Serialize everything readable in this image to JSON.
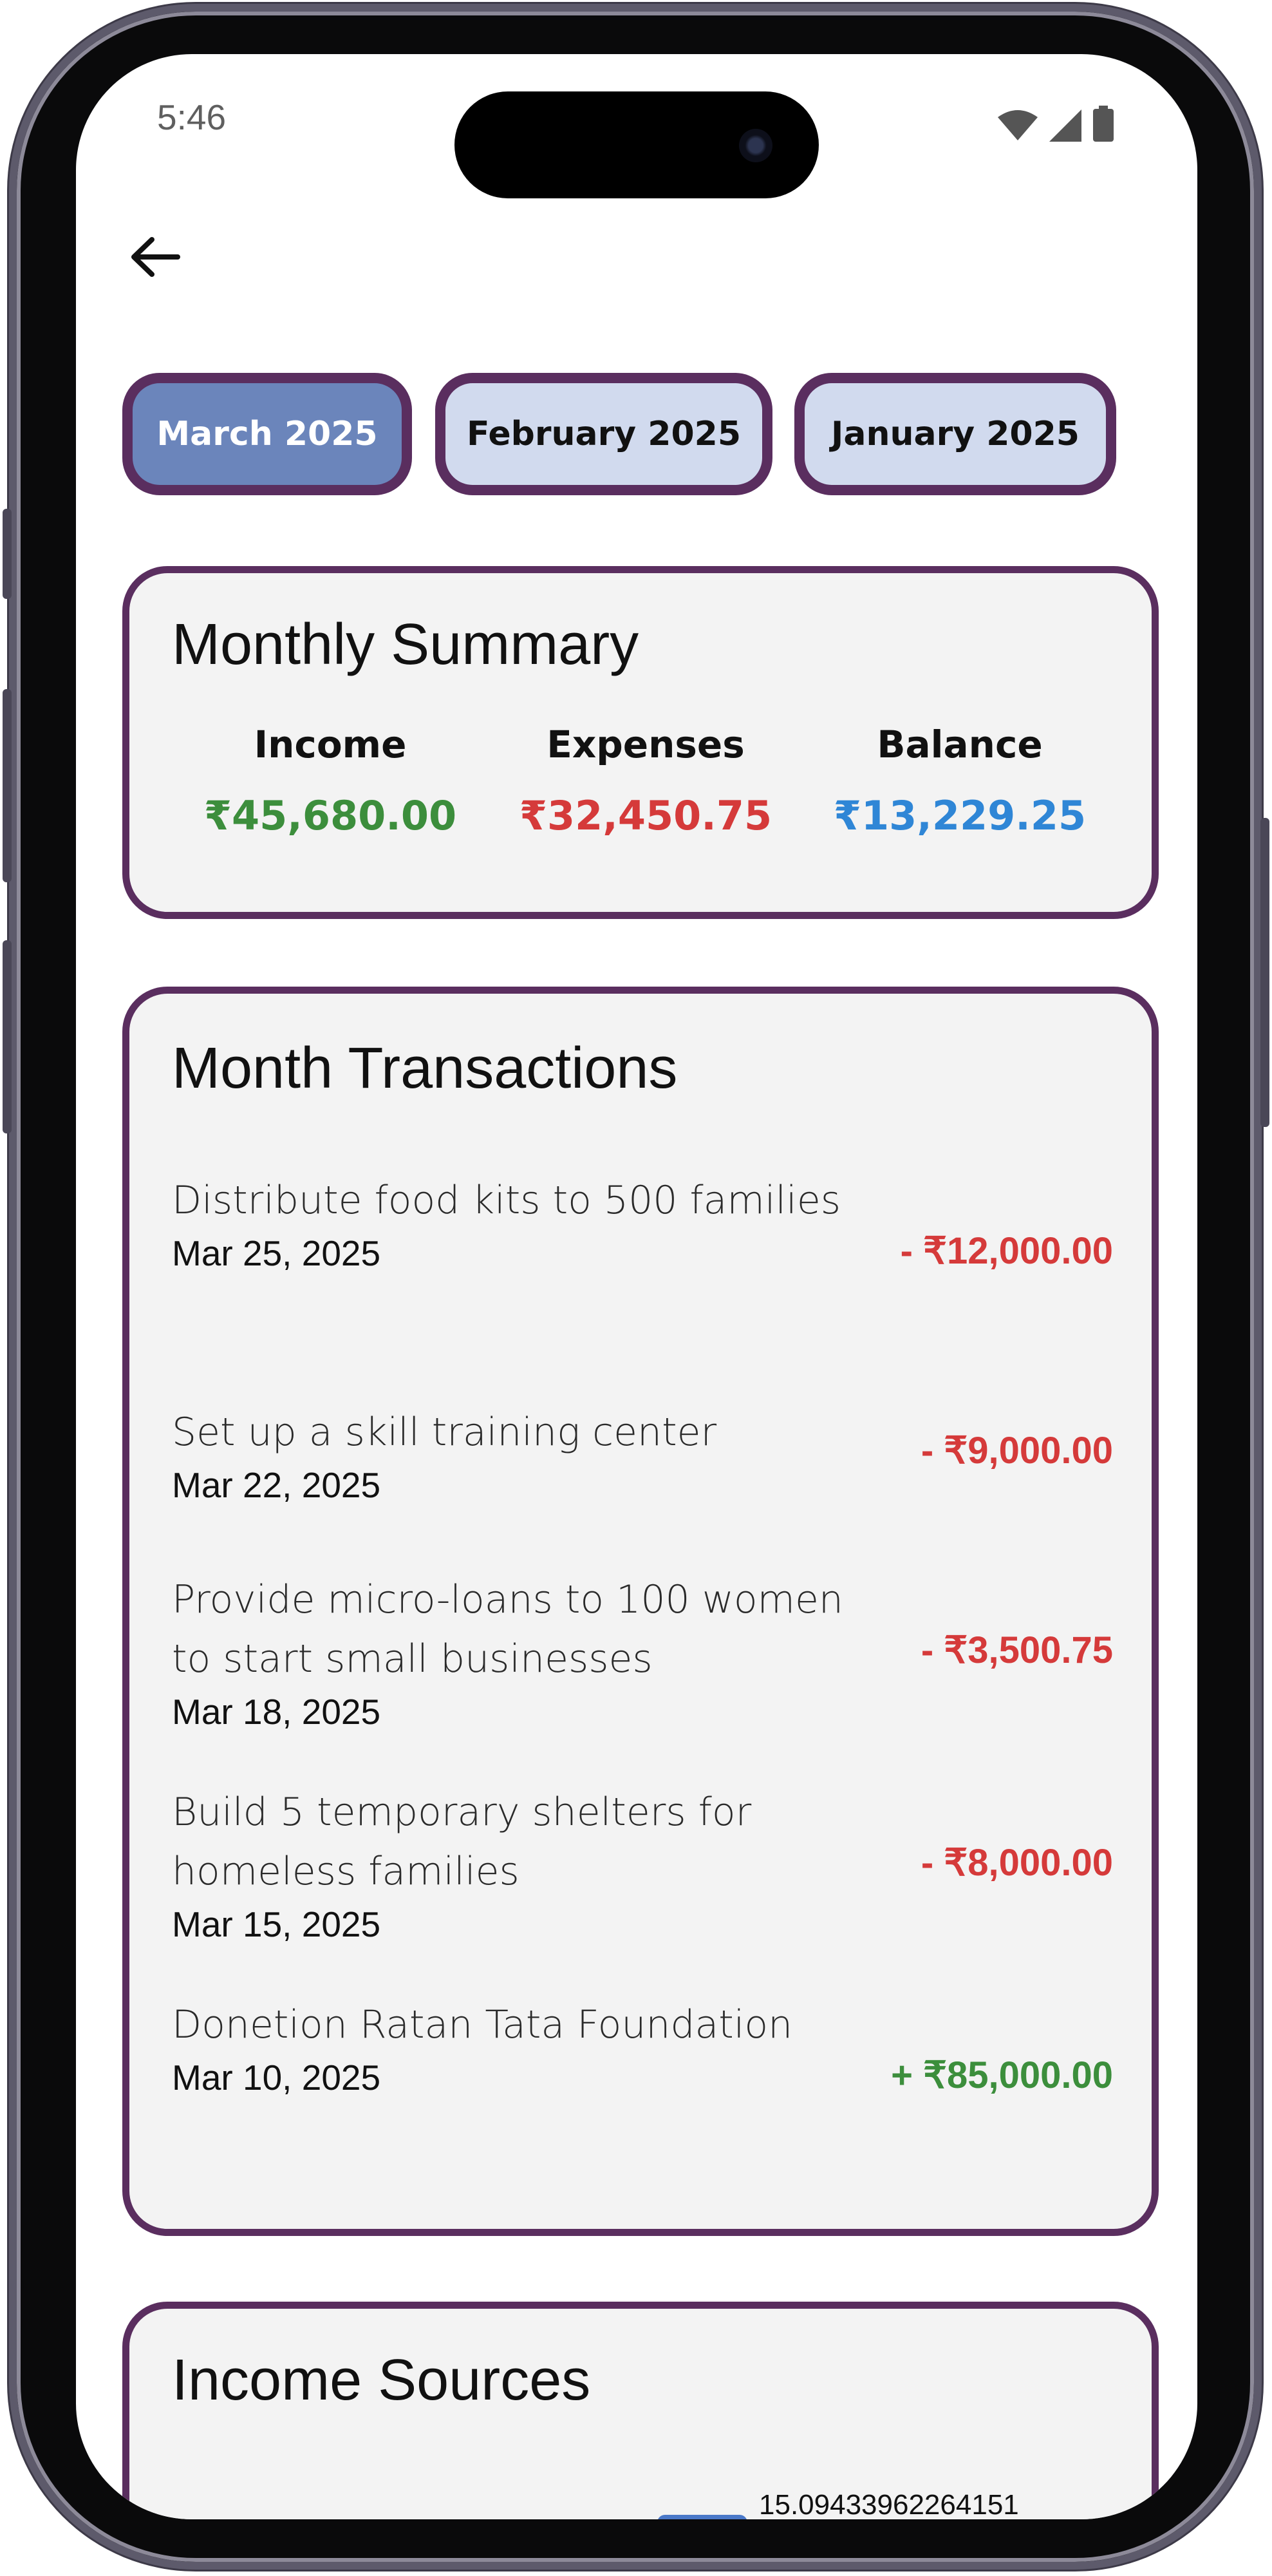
{
  "status_bar": {
    "time": "5:46",
    "icons": [
      "wifi-icon",
      "cell-signal-icon",
      "battery-icon"
    ]
  },
  "nav": {
    "back_icon": "arrow-left-icon"
  },
  "month_tabs": [
    {
      "label": "March 2025",
      "active": true
    },
    {
      "label": "February 2025",
      "active": false
    },
    {
      "label": "January 2025",
      "active": false
    }
  ],
  "summary": {
    "title": "Monthly Summary",
    "income_label": "Income",
    "income_value": "₹45,680.00",
    "expenses_label": "Expenses",
    "expenses_value": "₹32,450.75",
    "balance_label": "Balance",
    "balance_value": "₹13,229.25"
  },
  "transactions": {
    "title": "Month Transactions",
    "items": [
      {
        "title": "Distribute food kits to 500 families",
        "date": "Mar 25, 2025",
        "amount": "- ₹12,000.00",
        "type": "expense"
      },
      {
        "title": "Set up a skill training center",
        "date": "Mar 22, 2025",
        "amount": "- ₹9,000.00",
        "type": "expense"
      },
      {
        "title": "Provide micro-loans to 100 women to start small businesses",
        "date": "Mar 18, 2025",
        "amount": "- ₹3,500.75",
        "type": "expense"
      },
      {
        "title": "Build 5 temporary shelters for homeless families",
        "date": "Mar 15, 2025",
        "amount": "- ₹8,000.00",
        "type": "expense"
      },
      {
        "title": "Donetion Ratan Tata Foundation",
        "date": "Mar 10, 2025",
        "amount": "+ ₹85,000.00",
        "type": "income"
      }
    ]
  },
  "income_sources": {
    "title": "Income Sources",
    "partial_label": "15.09433962264151"
  },
  "colors": {
    "accent_border": "#5a2e5f",
    "active_tab": "#6b85bb",
    "inactive_tab": "#d1daee",
    "income": "#3c8e3c",
    "expense": "#d53a3a",
    "balance": "#2f86d6"
  }
}
